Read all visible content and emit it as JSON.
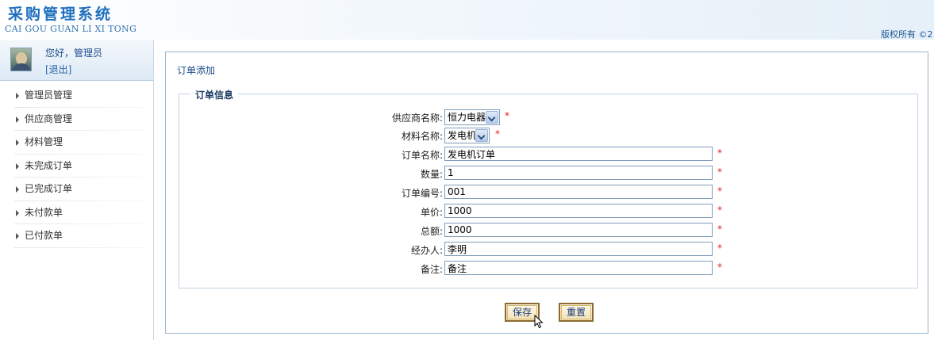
{
  "header": {
    "title_cn": "采购管理系统",
    "title_en": "CAI GOU GUAN LI XI TONG",
    "copyright": "版权所有 ©2"
  },
  "user": {
    "greeting": "您好，管理员",
    "logout": "[退出]"
  },
  "sidebar": {
    "items": [
      {
        "label": "管理员管理"
      },
      {
        "label": "供应商管理"
      },
      {
        "label": "材料管理"
      },
      {
        "label": "未完成订单"
      },
      {
        "label": "已完成订单"
      },
      {
        "label": "未付款单"
      },
      {
        "label": "已付款单"
      }
    ]
  },
  "main": {
    "breadcrumb": "订单添加",
    "legend": "订单信息",
    "fields": [
      {
        "label": "供应商名称:",
        "type": "select",
        "value": "恒力电器"
      },
      {
        "label": "材料名称:",
        "type": "select",
        "value": "发电机"
      },
      {
        "label": "订单名称:",
        "type": "text",
        "value": "发电机订单"
      },
      {
        "label": "数量:",
        "type": "text",
        "value": "1"
      },
      {
        "label": "订单编号:",
        "type": "text",
        "value": "001"
      },
      {
        "label": "单价:",
        "type": "text",
        "value": "1000"
      },
      {
        "label": "总额:",
        "type": "text",
        "value": "1000"
      },
      {
        "label": "经办人:",
        "type": "text",
        "value": "李明"
      },
      {
        "label": "备注:",
        "type": "text",
        "value": "备注"
      }
    ],
    "required_mark": "*",
    "save_label": "保存",
    "reset_label": "重置"
  },
  "colors": {
    "accent": "#1f6fbf",
    "required": "#e02020",
    "panel_border": "#99b5d0"
  }
}
